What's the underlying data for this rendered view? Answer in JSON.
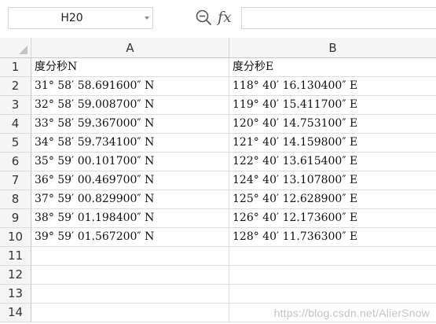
{
  "formula_bar": {
    "name_box": "H20",
    "fx_label": "fx",
    "formula_value": ""
  },
  "columns": [
    "A",
    "B"
  ],
  "rows": [
    {
      "num": "1",
      "a": "度分秒N",
      "b": "度分秒E"
    },
    {
      "num": "2",
      "a": "31° 58′ 58.691600″ N",
      "b": "118° 40′ 16.130400″ E"
    },
    {
      "num": "3",
      "a": "32° 58′ 59.008700″ N",
      "b": "119° 40′ 15.411700″ E"
    },
    {
      "num": "4",
      "a": "33° 58′ 59.367000″ N",
      "b": "120° 40′ 14.753100″ E"
    },
    {
      "num": "5",
      "a": "34° 58′ 59.734100″ N",
      "b": "121° 40′ 14.159800″ E"
    },
    {
      "num": "6",
      "a": "35° 59′ 00.101700″ N",
      "b": "122° 40′ 13.615400″ E"
    },
    {
      "num": "7",
      "a": "36° 59′ 00.469700″ N",
      "b": "124° 40′ 13.107800″ E"
    },
    {
      "num": "8",
      "a": "37° 59′ 00.829900″ N",
      "b": "125° 40′ 12.628900″ E"
    },
    {
      "num": "9",
      "a": "38° 59′ 01.198400″ N",
      "b": "126° 40′ 12.173600″ E"
    },
    {
      "num": "10",
      "a": "39° 59′ 01.567200″ N",
      "b": "128° 40′ 11.736300″ E"
    },
    {
      "num": "11",
      "a": "",
      "b": ""
    },
    {
      "num": "12",
      "a": "",
      "b": ""
    },
    {
      "num": "13",
      "a": "",
      "b": ""
    },
    {
      "num": "14",
      "a": "",
      "b": ""
    }
  ],
  "watermark": "https://blog.csdn.net/AlierSnow"
}
